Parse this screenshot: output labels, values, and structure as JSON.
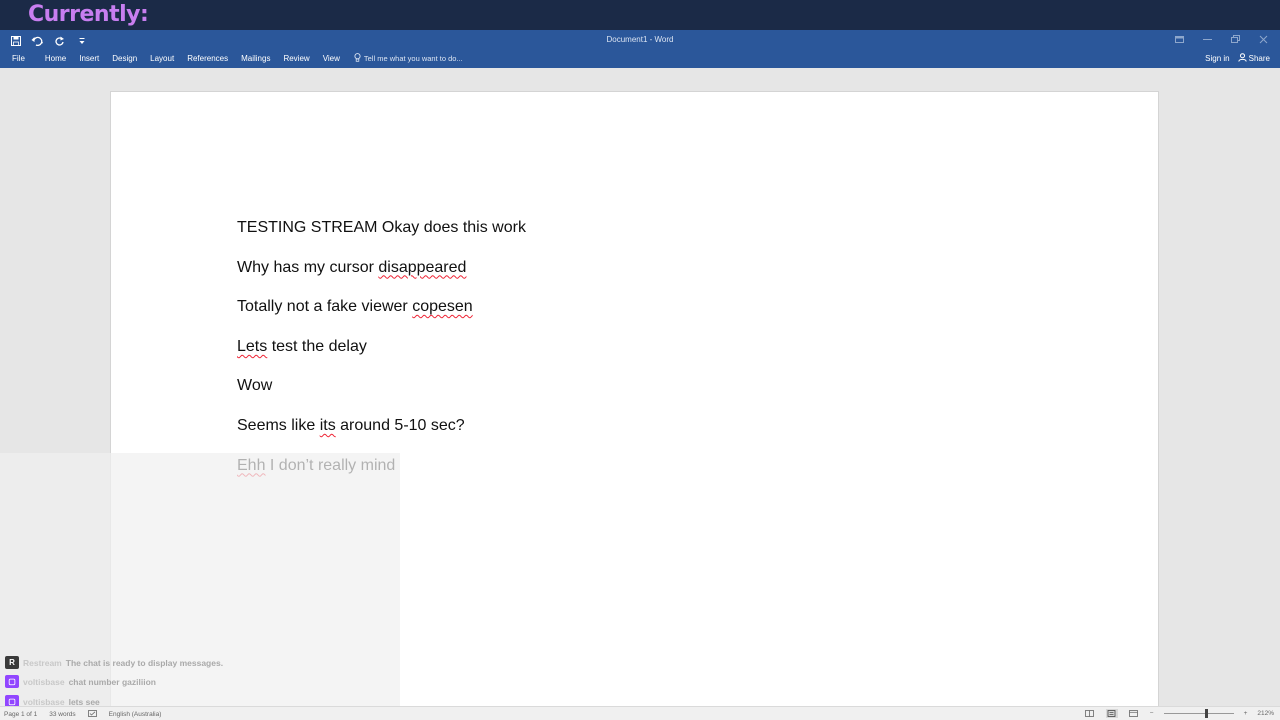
{
  "overlay": {
    "title": "Currently:",
    "title_color": "#c87ef0",
    "bar_color": "#1b2a47"
  },
  "window": {
    "title": "Document1 - Word",
    "accent": "#2b579a",
    "quick_access": [
      "save-icon",
      "undo-icon",
      "redo-icon",
      "customize-icon"
    ],
    "controls": [
      "ribbon-display-icon",
      "minimize-icon",
      "restore-icon",
      "close-icon"
    ]
  },
  "menu": {
    "file": "File",
    "tabs": [
      "Home",
      "Insert",
      "Design",
      "Layout",
      "References",
      "Mailings",
      "Review",
      "View"
    ],
    "tell_me": "Tell me what you want to do...",
    "sign_in": "Sign in",
    "share": "Share"
  },
  "document": {
    "paragraphs": [
      [
        {
          "t": "TESTING STREAM Okay does this work",
          "s": false
        }
      ],
      [
        {
          "t": "Why has my cursor ",
          "s": false
        },
        {
          "t": "disappeared",
          "s": true
        }
      ],
      [
        {
          "t": "Totally not a fake viewer ",
          "s": false
        },
        {
          "t": "copesen",
          "s": true
        }
      ],
      [
        {
          "t": "Lets",
          "s": true
        },
        {
          "t": " test the delay",
          "s": false
        }
      ],
      [
        {
          "t": "Wow",
          "s": false
        }
      ],
      [
        {
          "t": "Seems like ",
          "s": false
        },
        {
          "t": "its",
          "s": true
        },
        {
          "t": " around 5-10 sec?",
          "s": false
        }
      ],
      [
        {
          "t": "Ehh",
          "s": true
        },
        {
          "t": " I don’t really mind",
          "s": false
        }
      ]
    ]
  },
  "chat": {
    "messages": [
      {
        "user": "Restream",
        "text": "The chat is ready to display messages.",
        "badge": "R",
        "badge_color": "#3a3a3a"
      },
      {
        "user": "voltisbase",
        "text": "chat number gaziliion",
        "badge": "▢",
        "badge_color": "#9146ff"
      },
      {
        "user": "voltisbase",
        "text": "lets see",
        "badge": "▢",
        "badge_color": "#9146ff"
      }
    ]
  },
  "status": {
    "page": "Page 1 of 1",
    "words": "33 words",
    "language": "English (Australia)",
    "zoom": "212%",
    "zoom_fraction": 0.62
  }
}
